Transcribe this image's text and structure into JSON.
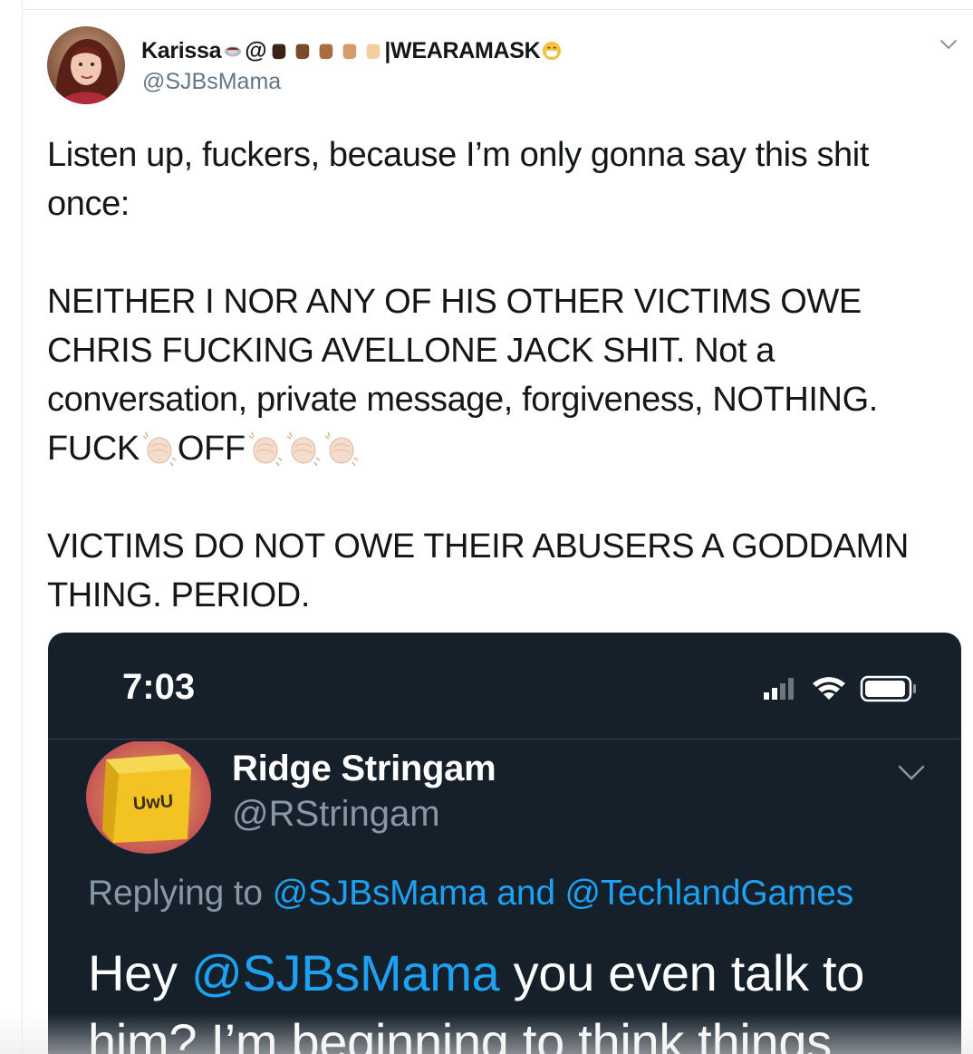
{
  "tweet": {
    "display_name_prefix": "Karissa",
    "display_name_at": "@",
    "display_name_suffix": "|WEARAMASK",
    "handle": "@SJBsMama",
    "emoji": [
      "teacup-icon",
      "fist-dark-icon",
      "fist-medium-dark-icon",
      "fist-medium-icon",
      "fist-medium-light-icon",
      "fist-light-icon",
      "mask-face-icon"
    ],
    "paragraph1_line1": "Listen up, fuckers, because I’m only gonna say this shit",
    "paragraph1_line2": "once:",
    "paragraph2_line1": "NEITHER I NOR ANY OF HIS OTHER VICTIMS OWE",
    "paragraph2_line2": "CHRIS FUCKING AVELLONE JACK SHIT. Not a",
    "paragraph2_line3": "conversation, private message, forgiveness, NOTHING.",
    "paragraph2_word_fuck": "FUCK",
    "paragraph2_word_off": "OFF",
    "paragraph3_line1": "VICTIMS DO NOT OWE THEIR ABUSERS A GODDAMN",
    "paragraph3_line2": "THING. PERIOD."
  },
  "embedded_screenshot": {
    "status_time": "7:03",
    "reply_author_name": "Ridge Stringam",
    "reply_author_handle": "@RStringam",
    "avatar_text": "UwU",
    "replying_prefix": "Replying to ",
    "replying_user1": "@SJBsMama",
    "replying_and": " and ",
    "replying_user2": "@TechlandGames",
    "body_hey": "Hey ",
    "body_mention": "@SJBsMama",
    "body_line1_rest": " you even talk to",
    "body_line2": "him? I’m beginning to think things"
  },
  "colors": {
    "text": "#14171a",
    "muted": "#657786",
    "link": "#1da1f2",
    "dark_bg": "#15202b",
    "dark_muted": "#8899a6"
  }
}
